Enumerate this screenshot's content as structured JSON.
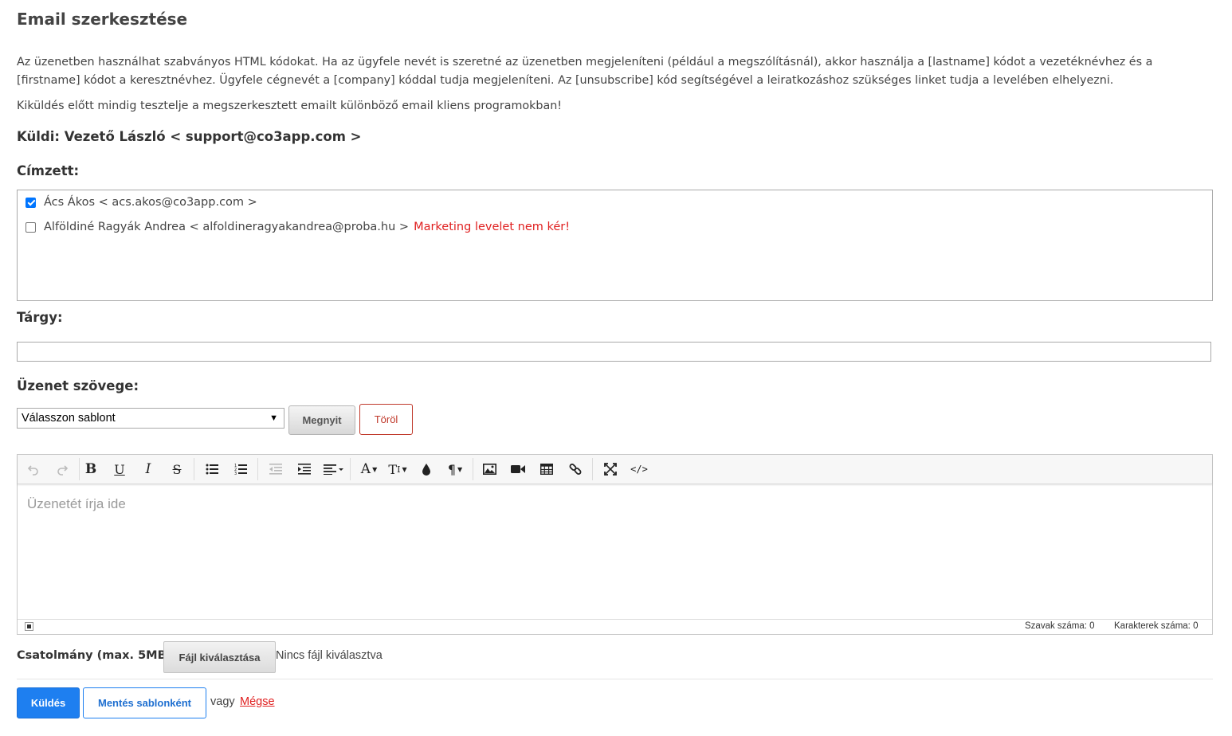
{
  "page": {
    "title": "Email szerkesztése",
    "intro": "Az üzenetben használhat szabványos HTML kódokat. Ha az ügyfele nevét is szeretné az üzenetben megjeleníteni (például a megszólításnál), akkor használja a [lastname] kódot a vezetéknévhez és a [firstname] kódot a keresztnévhez. Ügyfele cégnevét a [company] kóddal tudja megjeleníteni. Az [unsubscribe] kód segítségével a leiratkozáshoz szükséges linket tudja a levelében elhelyezni.",
    "test_note": "Kiküldés előtt mindig tesztelje a megszerkesztett emailt különböző email kliens programokban!",
    "sender": "Küldi: Vezető László < support@co3app.com >"
  },
  "recipients": {
    "label": "Címzett:",
    "items": [
      {
        "text": "Ács Ákos < acs.akos@co3app.com >",
        "checked": true,
        "warning": ""
      },
      {
        "text": "Alföldiné Ragyák Andrea < alfoldineragyakandrea@proba.hu >",
        "checked": false,
        "warning": "Marketing levelet nem kér!"
      }
    ]
  },
  "subject": {
    "label": "Tárgy:",
    "value": ""
  },
  "message": {
    "label": "Üzenet szövege:",
    "template_select": "Válasszon sablont",
    "open_button": "Megnyit",
    "delete_button": "Töröl",
    "placeholder": "Üzenetét írja ide",
    "word_count": "Szavak száma: 0",
    "char_count": "Karakterek száma: 0"
  },
  "toolbar": {
    "icons": [
      "undo-icon",
      "redo-icon",
      "bold-icon",
      "underline-icon",
      "italic-icon",
      "strikethrough-icon",
      "bullet-list-icon",
      "numbered-list-icon",
      "outdent-icon",
      "indent-icon",
      "align-icon",
      "font-family-icon",
      "font-size-icon",
      "color-icon",
      "paragraph-icon",
      "image-icon",
      "video-icon",
      "table-icon",
      "link-icon",
      "fullscreen-icon",
      "code-view-icon"
    ]
  },
  "attachment": {
    "label": "Csatolmány (max. 5MB):",
    "button": "Fájl kiválasztása",
    "status": "Nincs fájl kiválasztva"
  },
  "actions": {
    "send": "Küldés",
    "save_template": "Mentés sablonként",
    "or": "vagy",
    "cancel": "Mégse"
  },
  "colors": {
    "primary": "#1e7ff0",
    "danger": "#e02020",
    "delete": "#c0392b"
  }
}
